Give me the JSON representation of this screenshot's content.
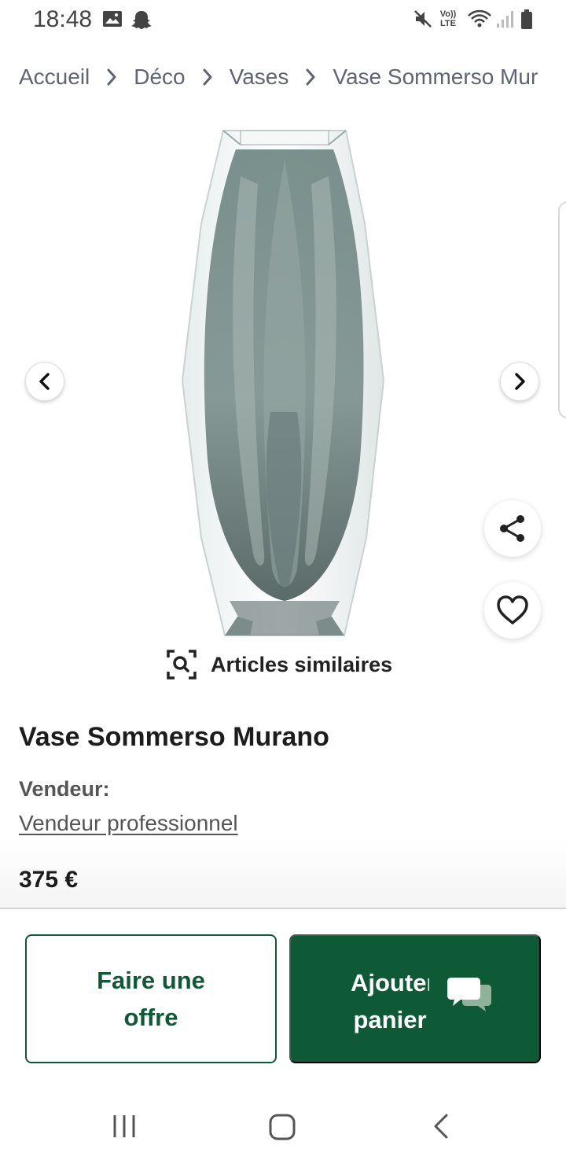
{
  "status_bar": {
    "time": "18:48",
    "volte_label": "Vo)) LTE",
    "icons": [
      "gallery-icon",
      "snapchat-icon",
      "mute-icon",
      "volte-icon",
      "wifi-icon",
      "signal-icon",
      "battery-icon"
    ]
  },
  "breadcrumb": {
    "items": [
      "Accueil",
      "Déco",
      "Vases",
      "Vase Sommerso Mur"
    ]
  },
  "gallery": {
    "image_alt": "Vase Sommerso Murano"
  },
  "similar": {
    "label": "Articles similaires"
  },
  "product": {
    "title": "Vase Sommerso Murano",
    "seller_label": "Vendeur:",
    "seller_value": "Vendeur professionnel",
    "price": "375 €"
  },
  "actions": {
    "offer_line1": "Faire une",
    "offer_line2": "offre",
    "cart_line1": "Ajouter au",
    "cart_line2": "panier"
  },
  "colors": {
    "brand_green": "#0f5a36",
    "text_dark": "#1c1c1c",
    "text_muted": "#5f6470"
  }
}
